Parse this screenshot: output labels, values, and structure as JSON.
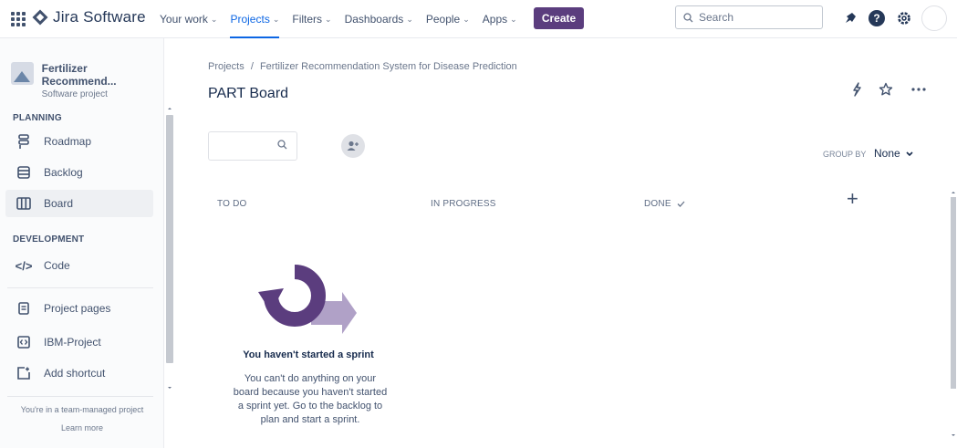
{
  "topnav": {
    "brand": "Jira Software",
    "items": [
      {
        "label": "Your work",
        "active": false
      },
      {
        "label": "Projects",
        "active": true
      },
      {
        "label": "Filters",
        "active": false
      },
      {
        "label": "Dashboards",
        "active": false
      },
      {
        "label": "People",
        "active": false
      },
      {
        "label": "Apps",
        "active": false
      }
    ],
    "create_label": "Create",
    "search_placeholder": "Search",
    "icons": [
      "notifications-icon",
      "help-icon",
      "settings-icon",
      "profile-avatar"
    ]
  },
  "sidebar": {
    "project_name": "Fertilizer Recommend...",
    "project_type": "Software project",
    "planning_title": "PLANNING",
    "planning_items": [
      {
        "label": "Roadmap",
        "icon": "roadmap-icon",
        "active": false
      },
      {
        "label": "Backlog",
        "icon": "backlog-icon",
        "active": false
      },
      {
        "label": "Board",
        "icon": "board-icon",
        "active": true
      }
    ],
    "development_title": "DEVELOPMENT",
    "development_items": [
      {
        "label": "Code",
        "icon": "code-icon",
        "active": false
      }
    ],
    "extra_items": [
      {
        "label": "Project pages",
        "icon": "page-icon"
      },
      {
        "label": "IBM-Project",
        "icon": "link-icon"
      },
      {
        "label": "Add shortcut",
        "icon": "add-shortcut-icon"
      }
    ],
    "team_note": "You're in a team-managed project",
    "learn_more": "Learn more"
  },
  "main": {
    "breadcrumb": {
      "root": "Projects",
      "separator": "/",
      "current": "Fertilizer Recommendation System for Disease Prediction"
    },
    "title": "PART Board",
    "groupby_label": "GROUP BY",
    "groupby_value": "None",
    "columns": [
      {
        "label": "TO DO",
        "done_check": false
      },
      {
        "label": "IN PROGRESS",
        "done_check": false
      },
      {
        "label": "DONE",
        "done_check": true
      }
    ],
    "empty_title": "You haven't started a sprint",
    "empty_desc": "You can't do anything on your board because you haven't started a sprint yet. Go to the backlog to plan and start a sprint."
  },
  "colors": {
    "brand_purple": "#5b3d7e",
    "illustration_purple": "#5b3d7e",
    "illustration_light": "#b0a1c7",
    "nav_active": "#0c66e4"
  }
}
